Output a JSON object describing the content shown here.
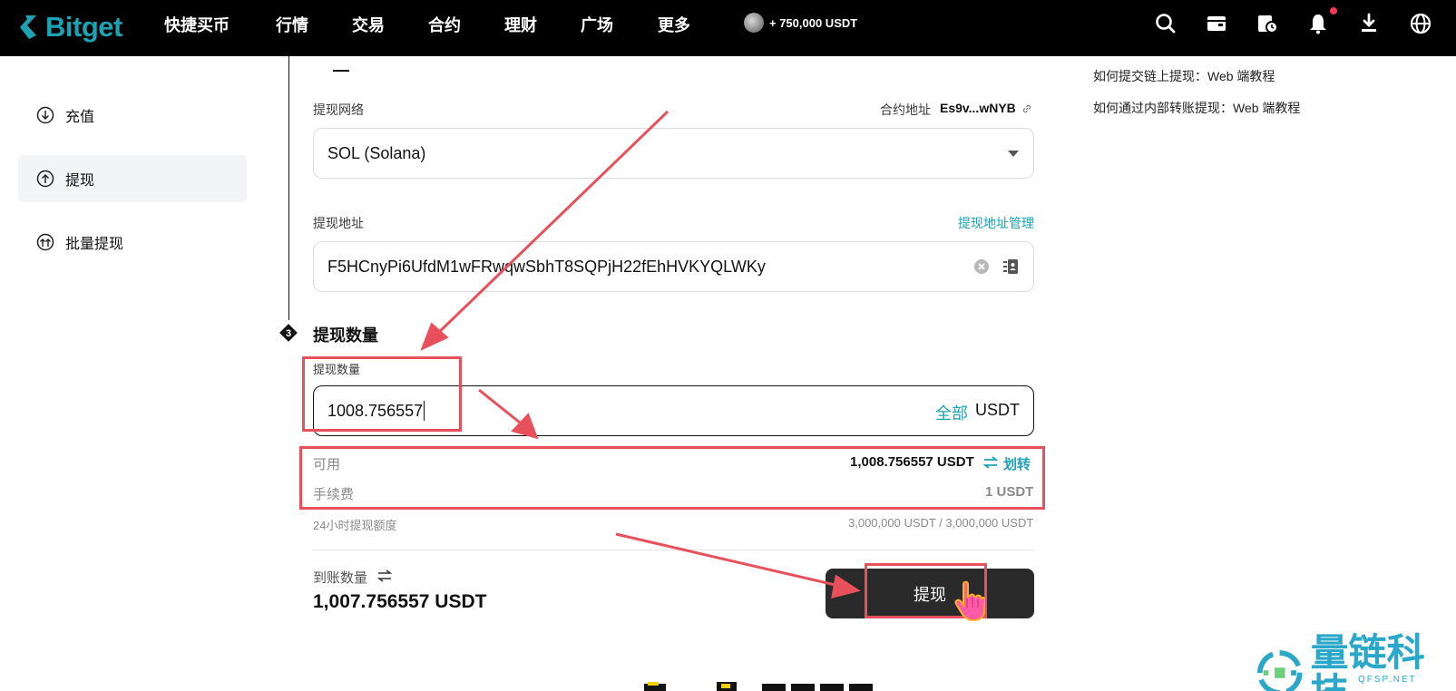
{
  "navbar": {
    "brand": "Bitget",
    "items": [
      "快捷买币",
      "行情",
      "交易",
      "合约",
      "理财",
      "广场",
      "更多"
    ],
    "promo": "+ 750,000 USDT",
    "icons": [
      "search-icon",
      "wallet-icon",
      "order-history-icon",
      "bell-icon",
      "download-icon",
      "globe-icon"
    ]
  },
  "sidebar": {
    "items": [
      {
        "label": "充值",
        "icon": "deposit-icon"
      },
      {
        "label": "提现",
        "icon": "withdraw-icon",
        "active": true
      },
      {
        "label": "批量提现",
        "icon": "batch-withdraw-icon"
      }
    ]
  },
  "form": {
    "network_label": "提现网络",
    "contract_label": "合约地址",
    "contract_value": "Es9v...wNYB",
    "network_value": "SOL (Solana)",
    "address_label": "提现地址",
    "address_manage": "提现地址管理",
    "address_value": "F5HCnyPi6UfdM1wFRwqwSbhT8SQPjH22fEhHVKYQLWKy",
    "step_number": "3",
    "amount_section_title": "提现数量",
    "amount_label": "提现数量",
    "amount_value": "1008.756557",
    "all_label": "全部",
    "currency": "USDT",
    "available_label": "可用",
    "available_value": "1,008.756557 USDT",
    "transfer_label": "划转",
    "fee_label": "手续费",
    "fee_value": "1 USDT",
    "limit_label": "24小时提现额度",
    "limit_value": "3,000,000 USDT / 3,000,000 USDT",
    "receive_label": "到账数量",
    "receive_value": "1,007.756557 USDT",
    "submit_label": "提现"
  },
  "help_links": [
    "如何提交链上提现：Web 端教程",
    "如何通过内部转账提现：Web 端教程"
  ],
  "watermark": {
    "text": "量链科技",
    "sub": "QFSP.NET"
  },
  "colors": {
    "accent": "#1da2b4",
    "annotation_red": "#e8505b",
    "button_dark": "#2a2a2a"
  }
}
